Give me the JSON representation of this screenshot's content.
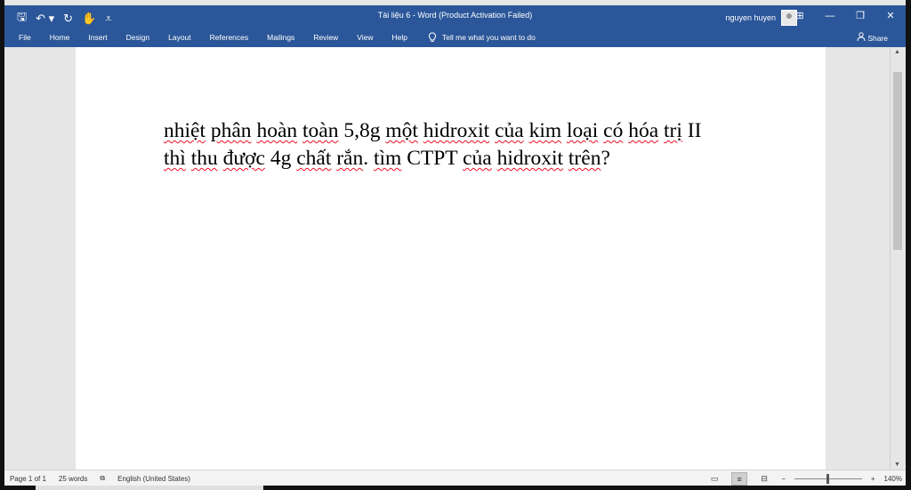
{
  "window": {
    "title": "Tài liệu 6  -  Word (Product Activation Failed)",
    "user_name": "nguyen huyen",
    "qat_icons": [
      "save-icon",
      "undo-icon",
      "redo-icon",
      "touch-mode-icon",
      "customize-icon"
    ],
    "qat_glyphs": {
      "save": "🖫",
      "undo": "↶ ▾",
      "redo": "↻",
      "touch": "✋",
      "customize": "⩡"
    },
    "controls": {
      "ribbon_display": "⊞",
      "minimize": "—",
      "restore": "❐",
      "close": "✕"
    }
  },
  "ribbon": {
    "tabs": [
      "File",
      "Home",
      "Insert",
      "Design",
      "Layout",
      "References",
      "Mailings",
      "Review",
      "View",
      "Help"
    ],
    "tell_me": "Tell me what you want to do",
    "tell_me_icon": "lightbulb-icon",
    "share": "Share",
    "share_icon": "person-icon"
  },
  "document": {
    "line1": [
      {
        "t": "nhiệt",
        "s": true
      },
      {
        "t": " "
      },
      {
        "t": "phân",
        "s": true
      },
      {
        "t": " "
      },
      {
        "t": "hoàn",
        "s": true
      },
      {
        "t": " "
      },
      {
        "t": "toàn",
        "s": true
      },
      {
        "t": " 5,8g "
      },
      {
        "t": "một",
        "s": true
      },
      {
        "t": " "
      },
      {
        "t": "hidroxit",
        "s": true
      },
      {
        "t": " "
      },
      {
        "t": "của",
        "s": true
      },
      {
        "t": " "
      },
      {
        "t": "kim",
        "s": true
      },
      {
        "t": " "
      },
      {
        "t": "loại",
        "s": true
      },
      {
        "t": " "
      },
      {
        "t": "có",
        "s": true
      },
      {
        "t": " "
      },
      {
        "t": "hóa",
        "s": true
      },
      {
        "t": " "
      },
      {
        "t": "trị",
        "s": true
      },
      {
        "t": " II"
      }
    ],
    "line2": [
      {
        "t": "thì",
        "s": true
      },
      {
        "t": " "
      },
      {
        "t": "thu",
        "s": true
      },
      {
        "t": " "
      },
      {
        "t": "được",
        "s": true
      },
      {
        "t": " 4g "
      },
      {
        "t": "chất",
        "s": true
      },
      {
        "t": " "
      },
      {
        "t": "rắn",
        "s": true
      },
      {
        "t": ". "
      },
      {
        "t": "tìm",
        "s": true
      },
      {
        "t": " CTPT "
      },
      {
        "t": "của",
        "s": true
      },
      {
        "t": " "
      },
      {
        "t": "hidroxit",
        "s": true
      },
      {
        "t": " "
      },
      {
        "t": "trên",
        "s": true
      },
      {
        "t": "?"
      }
    ]
  },
  "status": {
    "page": "Page 1 of 1",
    "words": "25 words",
    "language": "English (United States)",
    "zoom_minus": "−",
    "zoom_plus": "+",
    "zoom": "140%",
    "zoom_level": 0.5
  },
  "colors": {
    "accent": "#2b579a",
    "spell_error": "#e81123"
  }
}
